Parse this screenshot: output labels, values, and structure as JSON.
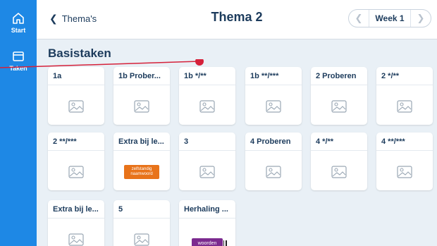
{
  "sidebar": {
    "items": [
      {
        "label": "Start",
        "icon": "home-icon"
      },
      {
        "label": "Taken",
        "icon": "tasks-icon"
      }
    ]
  },
  "header": {
    "back_label": "Thema's",
    "title": "Thema 2",
    "week_label": "Week 1"
  },
  "section": {
    "title": "Basistaken"
  },
  "cards": [
    {
      "title": "1a",
      "thumb": "image-placeholder-icon"
    },
    {
      "title": "1b Prober...",
      "thumb": "image-placeholder-icon"
    },
    {
      "title": "1b */**",
      "thumb": "image-placeholder-icon"
    },
    {
      "title": "1b **/***",
      "thumb": "image-placeholder-icon"
    },
    {
      "title": "2 Proberen",
      "thumb": "image-placeholder-icon"
    },
    {
      "title": "2 */**",
      "thumb": "image-placeholder-icon"
    },
    {
      "title": "2 **/***",
      "thumb": "image-placeholder-icon"
    },
    {
      "title": "Extra bij le...",
      "thumb": "badge",
      "badge_text": "zelfstandig naamwoord"
    },
    {
      "title": "3",
      "thumb": "image-placeholder-icon"
    },
    {
      "title": "4 Proberen",
      "thumb": "image-placeholder-icon"
    },
    {
      "title": "4 */**",
      "thumb": "image-placeholder-icon"
    },
    {
      "title": "4 **/***",
      "thumb": "image-placeholder-icon"
    },
    {
      "title": "Extra bij le...",
      "thumb": "image-placeholder-icon"
    },
    {
      "title": "5",
      "thumb": "image-placeholder-icon"
    },
    {
      "title": "Herhaling ...",
      "thumb": "badge",
      "badge_text": "woorden"
    }
  ],
  "colors": {
    "sidebar": "#1e88e5",
    "content_bg": "#e9f0f6",
    "text": "#1c3b5c",
    "badge_orange": "#e8731a",
    "badge_purple": "#7b2a8f",
    "pointer": "#d5213a"
  }
}
